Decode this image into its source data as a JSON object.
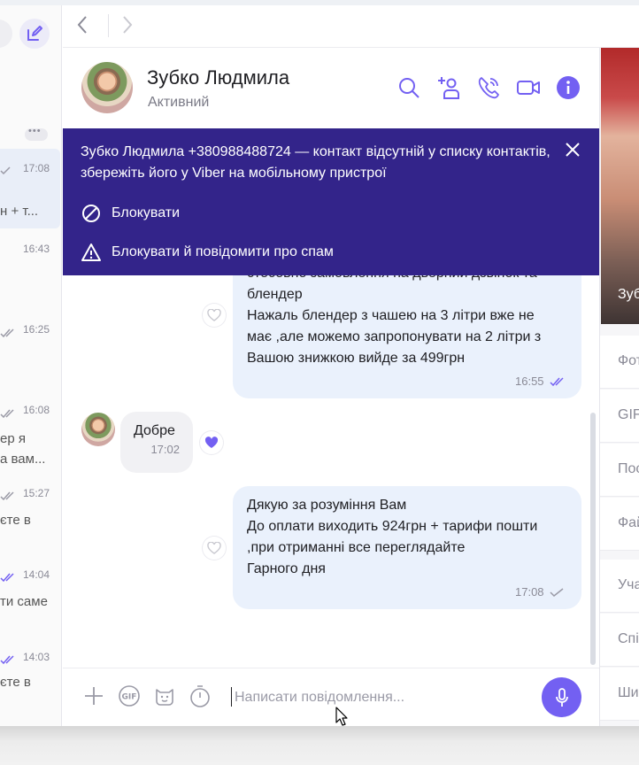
{
  "nav": {
    "back_icon": "chevron-left-icon",
    "forward_icon": "chevron-right-icon"
  },
  "contact": {
    "name": "Зубко Людмила",
    "status": "Активний"
  },
  "header_icons": [
    "search-icon",
    "add-participant-icon",
    "call-icon",
    "video-icon",
    "info-icon"
  ],
  "banner": {
    "message": "Зубко Людмила +380988488724 — контакт відсутній у списку контактів, збережіть його у Viber на мобільному пристрої",
    "block_label": "Блокувати",
    "block_spam_label": "Блокувати й повідомити про спам"
  },
  "sidebar": {
    "items": [
      {
        "time": "17:08",
        "preview": "н + т...",
        "status": "read"
      },
      {
        "time": "16:43",
        "preview": "",
        "status": "none"
      },
      {
        "time": "16:25",
        "preview": "",
        "status": "delivered"
      },
      {
        "time": "16:08",
        "preview": "ер я",
        "preview2": "а вам...",
        "status": "delivered"
      },
      {
        "time": "15:27",
        "preview": "єте в",
        "status": "delivered"
      },
      {
        "time": "14:04",
        "preview": "ти саме",
        "status": "read"
      },
      {
        "time": "14:03",
        "preview": "єте в",
        "status": "read"
      }
    ]
  },
  "messages": [
    {
      "direction": "outgoing",
      "lines": [
        "стосовно замовлення на дверний дзвінок та",
        "блендер",
        "Нажаль блендер з чашею на 3 літри вже не",
        "має ,але можемо запропонувати на 2 літри з",
        "Вашою знижкою вийде за 499грн"
      ],
      "time": "16:55",
      "status": "read"
    },
    {
      "direction": "incoming",
      "lines": [
        "Добре"
      ],
      "time": "17:02",
      "liked": true
    },
    {
      "direction": "outgoing",
      "lines": [
        "Дякую за розуміння Вам",
        "До оплати виходить 924грн + тарифи пошти",
        ",при отриманні все переглядайте",
        "Гарного дня"
      ],
      "time": "17:08",
      "status": "sent"
    }
  ],
  "composer": {
    "placeholder": "Написати повідомлення...",
    "icons": [
      "plus-icon",
      "gif-icon",
      "sticker-icon",
      "timer-icon",
      "microphone-icon"
    ]
  },
  "info_panel": {
    "photo_caption": "Зуб",
    "items": [
      "Фот",
      "GIF",
      "Пос",
      "Фай",
      "Уча",
      "Спі",
      "Ши"
    ]
  },
  "colors": {
    "accent": "#7360f2",
    "banner": "#33248a",
    "outgoing_bubble": "#eaf1fc",
    "incoming_bubble": "#f1f1f4"
  }
}
